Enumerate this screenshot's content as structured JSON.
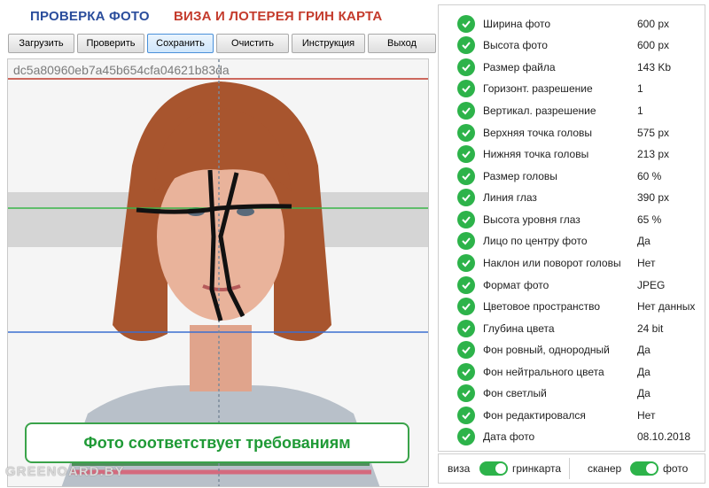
{
  "header": {
    "title_left": "ПРОВЕРКА ФОТО",
    "title_right": "ВИЗА И ЛОТЕРЕЯ ГРИН КАРТА"
  },
  "toolbar": {
    "buttons": [
      "Загрузить",
      "Проверить",
      "Сохранить",
      "Очистить",
      "Инструкция",
      "Выход"
    ]
  },
  "photo": {
    "hash": "dc5a80960eb7a45b654cfa04621b83da",
    "status_text": "Фото соответствует требованиям",
    "watermark": "GREENOARD.BY"
  },
  "checks": [
    {
      "label": "Ширина фото",
      "value": "600 px"
    },
    {
      "label": "Высота фото",
      "value": "600 px"
    },
    {
      "label": "Размер файла",
      "value": "143 Kb"
    },
    {
      "label": "Горизонт. разрешение",
      "value": "1"
    },
    {
      "label": "Вертикал. разрешение",
      "value": "1"
    },
    {
      "label": "Верхняя точка головы",
      "value": "575 px"
    },
    {
      "label": "Нижняя точка головы",
      "value": "213 px"
    },
    {
      "label": "Размер головы",
      "value": "60 %"
    },
    {
      "label": "Линия глаз",
      "value": "390 px"
    },
    {
      "label": "Высота уровня глаз",
      "value": "65 %"
    },
    {
      "label": "Лицо по центру фото",
      "value": "Да"
    },
    {
      "label": "Наклон или поворот головы",
      "value": "Нет"
    },
    {
      "label": "Формат фото",
      "value": "JPEG"
    },
    {
      "label": "Цветовое пространство",
      "value": "Нет данных"
    },
    {
      "label": "Глубина цвета",
      "value": "24 bit"
    },
    {
      "label": "Фон ровный, однородный",
      "value": "Да"
    },
    {
      "label": "Фон нейтрального цвета",
      "value": "Да"
    },
    {
      "label": "Фон светлый",
      "value": "Да"
    },
    {
      "label": "Фон редактировался",
      "value": "Нет"
    },
    {
      "label": "Дата фото",
      "value": "08.10.2018"
    }
  ],
  "bottom": {
    "toggle1_left": "виза",
    "toggle1_right": "гринкарта",
    "toggle2_left": "сканер",
    "toggle2_right": "фото"
  },
  "colors": {
    "check_green": "#2db34a",
    "status_green": "#1f9a36",
    "title_blue": "#2a4d9c",
    "title_red": "#c43b2c"
  }
}
